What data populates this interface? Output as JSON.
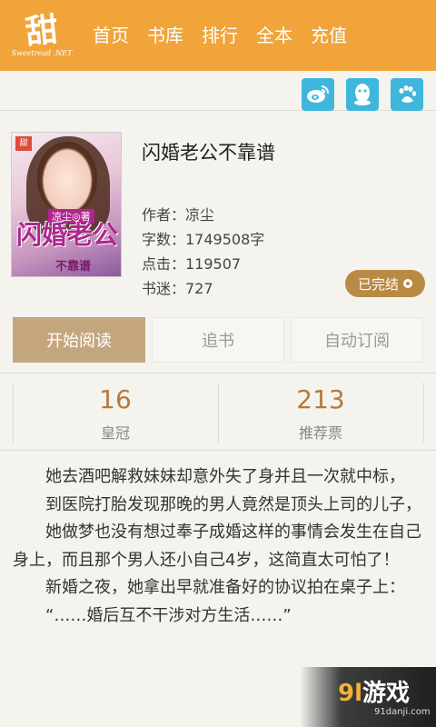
{
  "brand": {
    "logo_main": "甜",
    "logo_sub": "Sweetread .NET"
  },
  "nav": [
    {
      "label": "首页"
    },
    {
      "label": "书库"
    },
    {
      "label": "排行"
    },
    {
      "label": "全本"
    },
    {
      "label": "充值"
    }
  ],
  "share": [
    {
      "icon": "weibo-icon",
      "color": "#3fb6dc"
    },
    {
      "icon": "qq-icon",
      "color": "#3fb6dc"
    },
    {
      "icon": "baidu-paw-icon",
      "color": "#3fb6dc"
    }
  ],
  "book": {
    "title": "闪婚老公不靠谱",
    "cover": {
      "badge": "甜",
      "title": "闪婚老公",
      "subtitle": "不靠谱",
      "author": "凉尘◎著"
    },
    "author_label": "作者：凉尘",
    "words_label": "字数：1749508字",
    "clicks_label": "点击：119507",
    "fans_label": "书迷：727",
    "status": "已完结"
  },
  "actions": {
    "read": "开始阅读",
    "follow": "追书",
    "auto_subscribe": "自动订阅"
  },
  "stats": [
    {
      "value": "16",
      "label": "皇冠"
    },
    {
      "value": "213",
      "label": "推荐票"
    }
  ],
  "description": [
    "她去酒吧解救妹妹却意外失了身并且一次就中标，",
    "到医院打胎发现那晚的男人竟然是顶头上司的儿子，",
    "她做梦也没有想过奉子成婚这样的事情会发生在自己身上，而且那个男人还小自己4岁，这简直太可怕了！",
    "新婚之夜，她拿出早就准备好的协议拍在桌子上：",
    "“……婚后互不干涉对方生活……”"
  ],
  "watermark": {
    "num": "9l",
    "text": "游戏",
    "url": "91danji.com"
  },
  "colors": {
    "accent": "#f0a43a",
    "primary_button": "#c4a67e",
    "status": "#b98a44",
    "stat_number": "#b47a3c"
  }
}
